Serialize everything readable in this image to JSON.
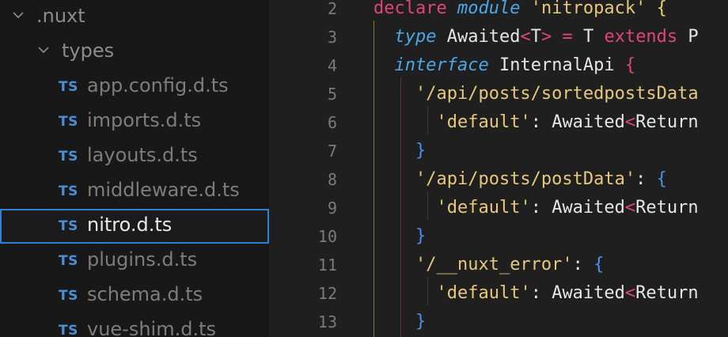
{
  "explorer": {
    "folders": [
      {
        "label": ".nuxt"
      },
      {
        "label": "types"
      }
    ],
    "files": [
      {
        "badge": "TS",
        "label": "app.config.d.ts"
      },
      {
        "badge": "TS",
        "label": "imports.d.ts"
      },
      {
        "badge": "TS",
        "label": "layouts.d.ts"
      },
      {
        "badge": "TS",
        "label": "middleware.d.ts"
      },
      {
        "badge": "TS",
        "label": "nitro.d.ts",
        "selected": true
      },
      {
        "badge": "TS",
        "label": "plugins.d.ts"
      },
      {
        "badge": "TS",
        "label": "schema.d.ts"
      },
      {
        "badge": "TS",
        "label": "vue-shim.d.ts"
      }
    ]
  },
  "editor": {
    "line_numbers": [
      "2",
      "3",
      "4",
      "5",
      "6",
      "7",
      "8",
      "9",
      "10",
      "11",
      "12",
      "13"
    ],
    "lines": [
      [
        {
          "t": "declare ",
          "c": "kw"
        },
        {
          "t": "module",
          "c": "kwi"
        },
        {
          "t": " ",
          "c": "plain"
        },
        {
          "t": "'nitropack'",
          "c": "str"
        },
        {
          "t": " ",
          "c": "plain"
        },
        {
          "t": "{",
          "c": "brace-y"
        }
      ],
      [
        {
          "t": "  ",
          "c": "plain"
        },
        {
          "t": "type",
          "c": "kwi"
        },
        {
          "t": " Awaited",
          "c": "plain"
        },
        {
          "t": "<",
          "c": "punct"
        },
        {
          "t": "T",
          "c": "plain"
        },
        {
          "t": ">",
          "c": "punct"
        },
        {
          "t": " ",
          "c": "plain"
        },
        {
          "t": "=",
          "c": "punct"
        },
        {
          "t": " T ",
          "c": "plain"
        },
        {
          "t": "extends",
          "c": "kw"
        },
        {
          "t": " P",
          "c": "plain"
        }
      ],
      [
        {
          "t": "  ",
          "c": "plain"
        },
        {
          "t": "interface",
          "c": "kwi"
        },
        {
          "t": " InternalApi ",
          "c": "plain"
        },
        {
          "t": "{",
          "c": "punct"
        }
      ],
      [
        {
          "t": "    ",
          "c": "plain"
        },
        {
          "t": "'/api/posts/sortedpostsData",
          "c": "str"
        }
      ],
      [
        {
          "t": "      ",
          "c": "plain"
        },
        {
          "t": "'default'",
          "c": "str"
        },
        {
          "t": ": Awaited",
          "c": "plain"
        },
        {
          "t": "<",
          "c": "punct"
        },
        {
          "t": "Return",
          "c": "plain"
        }
      ],
      [
        {
          "t": "    ",
          "c": "plain"
        },
        {
          "t": "}",
          "c": "brace"
        }
      ],
      [
        {
          "t": "    ",
          "c": "plain"
        },
        {
          "t": "'/api/posts/postData'",
          "c": "str"
        },
        {
          "t": ": ",
          "c": "plain"
        },
        {
          "t": "{",
          "c": "brace"
        }
      ],
      [
        {
          "t": "      ",
          "c": "plain"
        },
        {
          "t": "'default'",
          "c": "str"
        },
        {
          "t": ": Awaited",
          "c": "plain"
        },
        {
          "t": "<",
          "c": "punct"
        },
        {
          "t": "Return",
          "c": "plain"
        }
      ],
      [
        {
          "t": "    ",
          "c": "plain"
        },
        {
          "t": "}",
          "c": "brace"
        }
      ],
      [
        {
          "t": "    ",
          "c": "plain"
        },
        {
          "t": "'/__nuxt_error'",
          "c": "str"
        },
        {
          "t": ": ",
          "c": "plain"
        },
        {
          "t": "{",
          "c": "brace"
        }
      ],
      [
        {
          "t": "      ",
          "c": "plain"
        },
        {
          "t": "'default'",
          "c": "str"
        },
        {
          "t": ": Awaited",
          "c": "plain"
        },
        {
          "t": "<",
          "c": "punct"
        },
        {
          "t": "Return",
          "c": "plain"
        }
      ],
      [
        {
          "t": "    ",
          "c": "plain"
        },
        {
          "t": "}",
          "c": "brace"
        }
      ]
    ]
  },
  "colors": {
    "accent": "#2f7fd3",
    "ts_badge": "#4a90d9",
    "keyword": "#e0447a",
    "italic_keyword": "#4aa8e8",
    "string": "#e8c87a"
  },
  "icons": {
    "folder_expanded": "chevron-down-icon",
    "file_type": "typescript-icon"
  }
}
